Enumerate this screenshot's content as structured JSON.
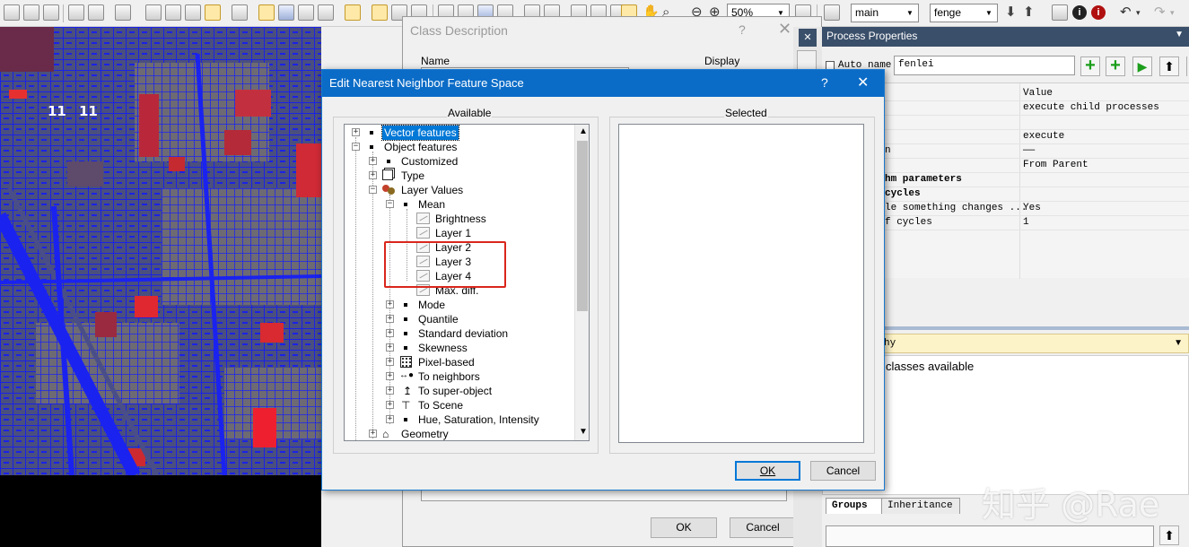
{
  "toolbar": {
    "zoom": "50%",
    "map_select": "main",
    "image_select": "fenge"
  },
  "map": {
    "labels": [
      "11",
      "11"
    ]
  },
  "class_desc": {
    "title": "Class Description",
    "help": "?",
    "close": "✕",
    "name_label": "Name",
    "display_label": "Display",
    "ok": "OK",
    "cancel": "Cancel"
  },
  "process": {
    "title": "Process Properties",
    "auto_name": "Auto name",
    "name_value": "fenlei",
    "rows": [
      {
        "left": "",
        "right": "Value"
      },
      {
        "left": "",
        "right": "execute child processes"
      },
      {
        "left": "",
        "right": ""
      },
      {
        "left": "",
        "right": "execute"
      },
      {
        "left": "n",
        "right": "——"
      },
      {
        "left": "",
        "right": "From Parent"
      },
      {
        "left": "hm parameters",
        "right": ""
      },
      {
        "left": "cycles",
        "right": ""
      },
      {
        "left": "le something changes ...",
        "right": "Yes"
      },
      {
        "left": "f cycles",
        "right": "1"
      }
    ],
    "hierarchy_label": "hy",
    "classes_text": "classes available",
    "tab_groups": "Groups",
    "tab_inheritance": "Inheritance"
  },
  "dialog": {
    "title": "Edit Nearest Neighbor Feature Space",
    "help": "?",
    "close": "✕",
    "available_label": "Available",
    "selected_label": "Selected",
    "ok": "OK",
    "cancel": "Cancel",
    "tree": {
      "vector_features": "Vector features",
      "object_features": "Object features",
      "customized": "Customized",
      "type": "Type",
      "layer_values": "Layer Values",
      "mean": "Mean",
      "brightness": "Brightness",
      "layer1": "Layer 1",
      "layer2": "Layer 2",
      "layer3": "Layer 3",
      "layer4": "Layer 4",
      "maxdiff": "Max. diff.",
      "mode": "Mode",
      "quantile": "Quantile",
      "stddev": "Standard deviation",
      "skewness": "Skewness",
      "pixel_based": "Pixel-based",
      "to_neighbors": "To neighbors",
      "to_super": "To super-object",
      "to_scene": "To Scene",
      "hsi": "Hue, Saturation, Intensity",
      "geometry": "Geometry"
    }
  },
  "watermark": "知乎 @Rae",
  "colors": {
    "titlebar": "#0b6cc7",
    "highlight_box": "#d9261c",
    "selection": "#0078d7",
    "panel_title": "#3a4f6a"
  }
}
